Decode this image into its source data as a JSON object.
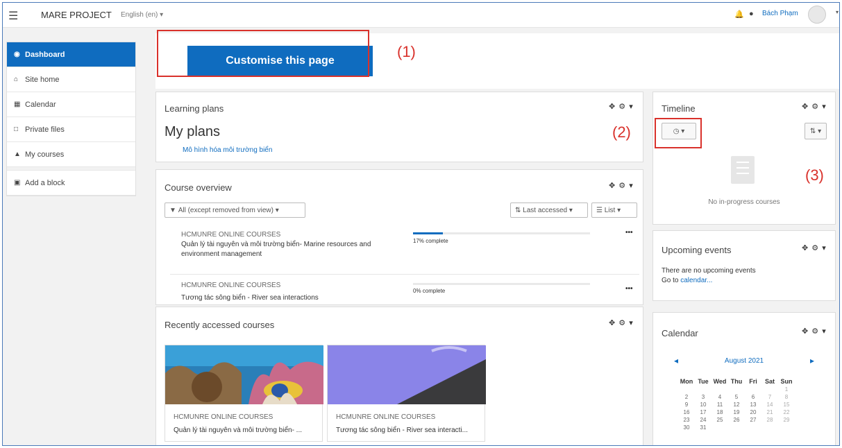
{
  "navbar": {
    "menu_icon": "hamburger-icon",
    "site_name": "MARE PROJECT",
    "language": "English (en)",
    "user_name": "Bách Phạm"
  },
  "drawer": {
    "items": [
      {
        "label": "Dashboard",
        "icon": "dashboard-icon",
        "active": true
      },
      {
        "label": "Site home",
        "icon": "home-icon"
      },
      {
        "label": "Calendar",
        "icon": "calendar-icon"
      },
      {
        "label": "Private files",
        "icon": "file-icon"
      },
      {
        "label": "My courses",
        "icon": "graduation-cap-icon"
      },
      {
        "label": "Add a block",
        "icon": "plus-square-icon"
      }
    ]
  },
  "main": {
    "customise_label": "Customise this page",
    "annotations": [
      "(1)",
      "(2)",
      "(3)"
    ],
    "learning_plans": {
      "title": "Learning plans",
      "heading": "My plans",
      "plan_link": "Mô hình hóa môi trường biển"
    },
    "course_overview": {
      "title": "Course overview",
      "filter_label": "All (except removed from view)",
      "sort_label": "Last accessed",
      "view_label": "List",
      "courses": [
        {
          "category": "HCMUNRE ONLINE COURSES",
          "name": "Quản lý tài nguyên và môi trường biển- Marine resources and environment management",
          "progress": 17,
          "progress_text": "17% complete"
        },
        {
          "category": "HCMUNRE ONLINE COURSES",
          "name": "Tương tác sông biển - River sea interactions",
          "progress": 0,
          "progress_text": "0% complete"
        }
      ]
    },
    "recent_courses": {
      "title": "Recently accessed courses",
      "courses": [
        {
          "category": "HCMUNRE ONLINE COURSES",
          "name": "Quản lý tài nguyên và môi trường biển- ..."
        },
        {
          "category": "HCMUNRE ONLINE COURSES",
          "name": "Tương tác sông biển - River sea interacti..."
        }
      ]
    }
  },
  "right": {
    "timeline": {
      "title": "Timeline",
      "empty_text": "No in-progress courses"
    },
    "upcoming": {
      "title": "Upcoming events",
      "empty_text": "There are no upcoming events",
      "link_prefix": "Go to ",
      "link_text": "calendar..."
    },
    "calendar": {
      "title": "Calendar",
      "month": "August 2021",
      "days": [
        "Mon",
        "Tue",
        "Wed",
        "Thu",
        "Fri",
        "Sat",
        "Sun"
      ],
      "weeks": [
        [
          "",
          "",
          "",
          "",
          "",
          "",
          "1"
        ],
        [
          "2",
          "3",
          "4",
          "5",
          "6",
          "7",
          "8"
        ],
        [
          "9",
          "10",
          "11",
          "12",
          "13",
          "14",
          "15"
        ],
        [
          "16",
          "17",
          "18",
          "19",
          "20",
          "21",
          "22"
        ],
        [
          "23",
          "24",
          "25",
          "26",
          "27",
          "28",
          "29"
        ],
        [
          "30",
          "31",
          "",
          "",
          "",
          "",
          ""
        ]
      ]
    }
  },
  "colors": {
    "brand": "#0f6cbf",
    "annotation": "#d9312b"
  }
}
